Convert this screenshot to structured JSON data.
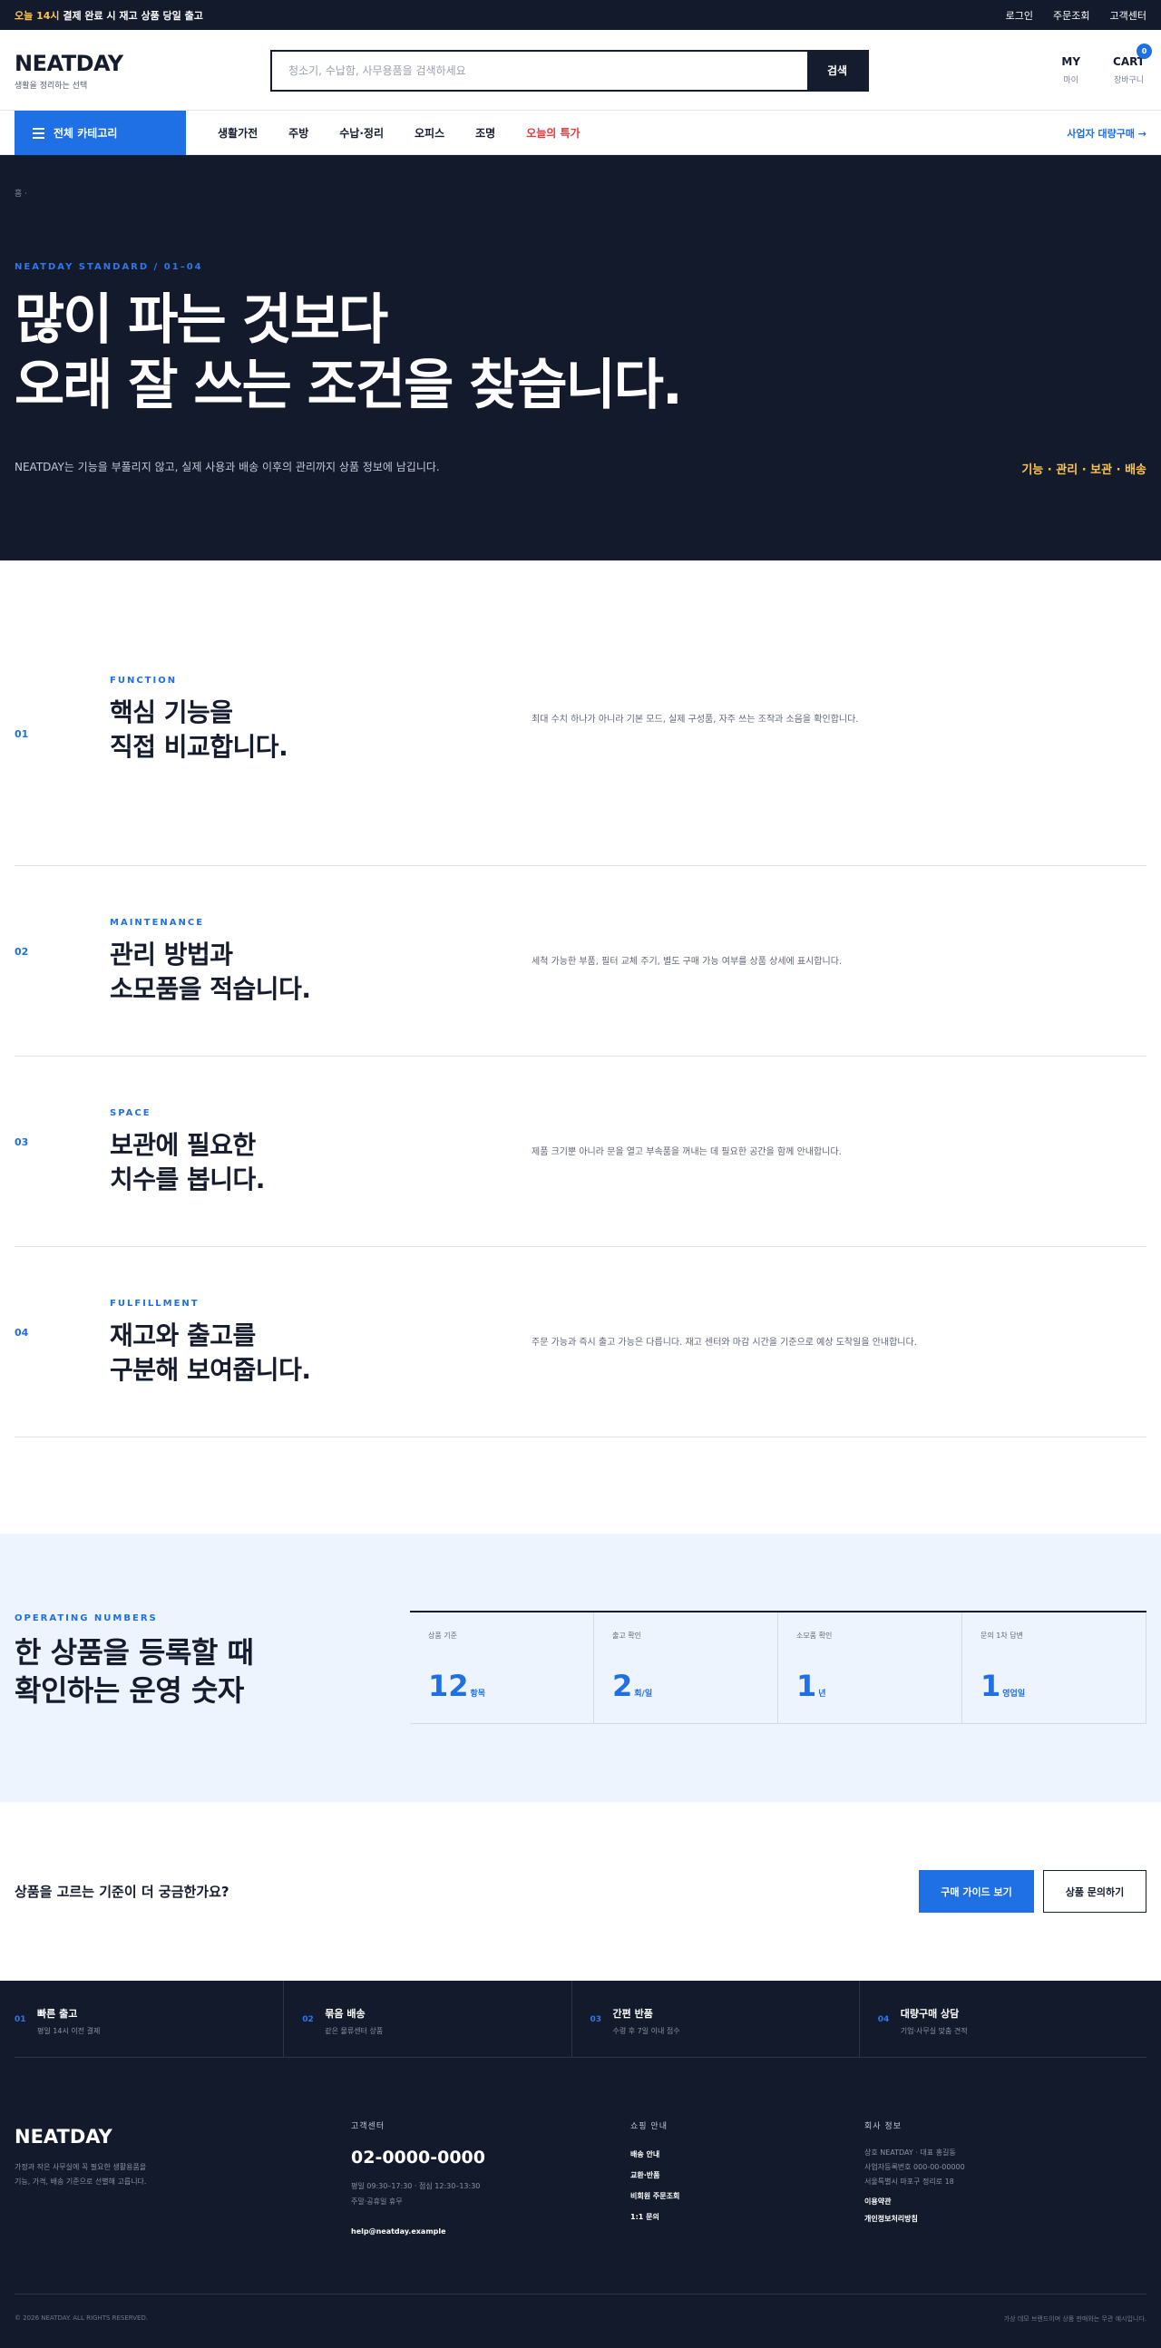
{
  "topbar": {
    "notice_highlight": "오늘 14시",
    "notice_rest": " 결제 완료 시 재고 상품 당일 출고",
    "links": [
      "로그인",
      "주문조회",
      "고객센터"
    ]
  },
  "header": {
    "logo": "NEATDAY",
    "tagline": "생활을 정리하는 선택",
    "search_placeholder": "청소기, 수납함, 사무용품을 검색하세요",
    "search_button": "검색",
    "my_label": "MY",
    "my_sub": "마이",
    "cart_label": "CART",
    "cart_sub": "장바구니",
    "cart_count": "0"
  },
  "nav": {
    "all_categories": "전체 카테고리",
    "items": [
      "생활가전",
      "주방",
      "수납·정리",
      "오피스",
      "조명"
    ],
    "sale": "오늘의 특가",
    "business": "사업자 대량구매 →"
  },
  "hero": {
    "breadcrumb": "홈 ·",
    "eyebrow": "NEATDAY STANDARD / 01–04",
    "title_line1": "많이 파는 것보다",
    "title_line2": "오래 잘 쓰는 조건을 찾습니다.",
    "description": "NEATDAY는 기능을 부풀리지 않고, 실제 사용과 배송 이후의 관리까지 상품 정보에 남깁니다.",
    "tags": "기능 · 관리 · 보관 · 배송"
  },
  "features": [
    {
      "num": "01",
      "kicker": "FUNCTION",
      "title_line1": "핵심 기능을",
      "title_line2": "직접 비교합니다.",
      "desc": "최대 수치 하나가 아니라 기본 모드, 실제 구성품, 자주 쓰는 조작과 소음을 확인합니다."
    },
    {
      "num": "02",
      "kicker": "MAINTENANCE",
      "title_line1": "관리 방법과",
      "title_line2": "소모품을 적습니다.",
      "desc": "세척 가능한 부품, 필터 교체 주기, 별도 구매 가능 여부를 상품 상세에 표시합니다."
    },
    {
      "num": "03",
      "kicker": "SPACE",
      "title_line1": "보관에 필요한",
      "title_line2": "치수를 봅니다.",
      "desc": "제품 크기뿐 아니라 문을 열고 부속품을 꺼내는 데 필요한 공간을 함께 안내합니다."
    },
    {
      "num": "04",
      "kicker": "FULFILLMENT",
      "title_line1": "재고와 출고를",
      "title_line2": "구분해 보여줍니다.",
      "desc": "주문 가능과 즉시 출고 가능은 다릅니다. 재고 센터와 마감 시간을 기준으로 예상 도착일을 안내합니다."
    }
  ],
  "numbers": {
    "kicker": "OPERATING NUMBERS",
    "title_line1": "한 상품을 등록할 때",
    "title_line2": "확인하는 운영 숫자",
    "stats": [
      {
        "label": "상품 기준",
        "value": "12",
        "unit": "항목"
      },
      {
        "label": "출고 확인",
        "value": "2",
        "unit": "회/일"
      },
      {
        "label": "소모품 확인",
        "value": "1",
        "unit": "년"
      },
      {
        "label": "문의 1차 답변",
        "value": "1",
        "unit": "영업일"
      }
    ]
  },
  "cta": {
    "question": "상품을 고르는 기준이 더 궁금한가요?",
    "primary": "구매 가이드 보기",
    "secondary": "상품 문의하기"
  },
  "footer": {
    "services": [
      {
        "num": "01",
        "title": "빠른 출고",
        "sub": "평일 14시 이전 결제"
      },
      {
        "num": "02",
        "title": "묶음 배송",
        "sub": "같은 물류센터 상품"
      },
      {
        "num": "03",
        "title": "간편 반품",
        "sub": "수령 후 7일 이내 접수"
      },
      {
        "num": "04",
        "title": "대량구매 상담",
        "sub": "기업·사무실 맞춤 견적"
      }
    ],
    "logo": "NEATDAY",
    "brand_desc_1": "가정과 작은 사무실에 꼭 필요한 생활용품을",
    "brand_desc_2": "기능, 가격, 배송 기준으로 선별해 고릅니다.",
    "cs_heading": "고객센터",
    "phone": "02-0000-0000",
    "hours_1": "평일 09:30–17:30 · 점심 12:30–13:30",
    "hours_2": "주말·공휴일 휴무",
    "email": "help@neatday.example",
    "shop_heading": "쇼핑 안내",
    "shop_links": [
      "배송 안내",
      "교환·반품",
      "비회원 주문조회",
      "1:1 문의"
    ],
    "company_heading": "회사 정보",
    "company_info_1": "상호 NEATDAY · 대표 홍길동",
    "company_info_2": "사업자등록번호 000-00-00000",
    "company_info_3": "서울특별시 마포구 정리로 18",
    "policy_links": [
      "이용약관",
      "개인정보처리방침"
    ],
    "copyright": "© 2026 NEATDAY. ALL RIGHTS RESERVED.",
    "disclaimer": "가상 데모 브랜드이며 상품 판매와는 무관 예시입니다."
  }
}
